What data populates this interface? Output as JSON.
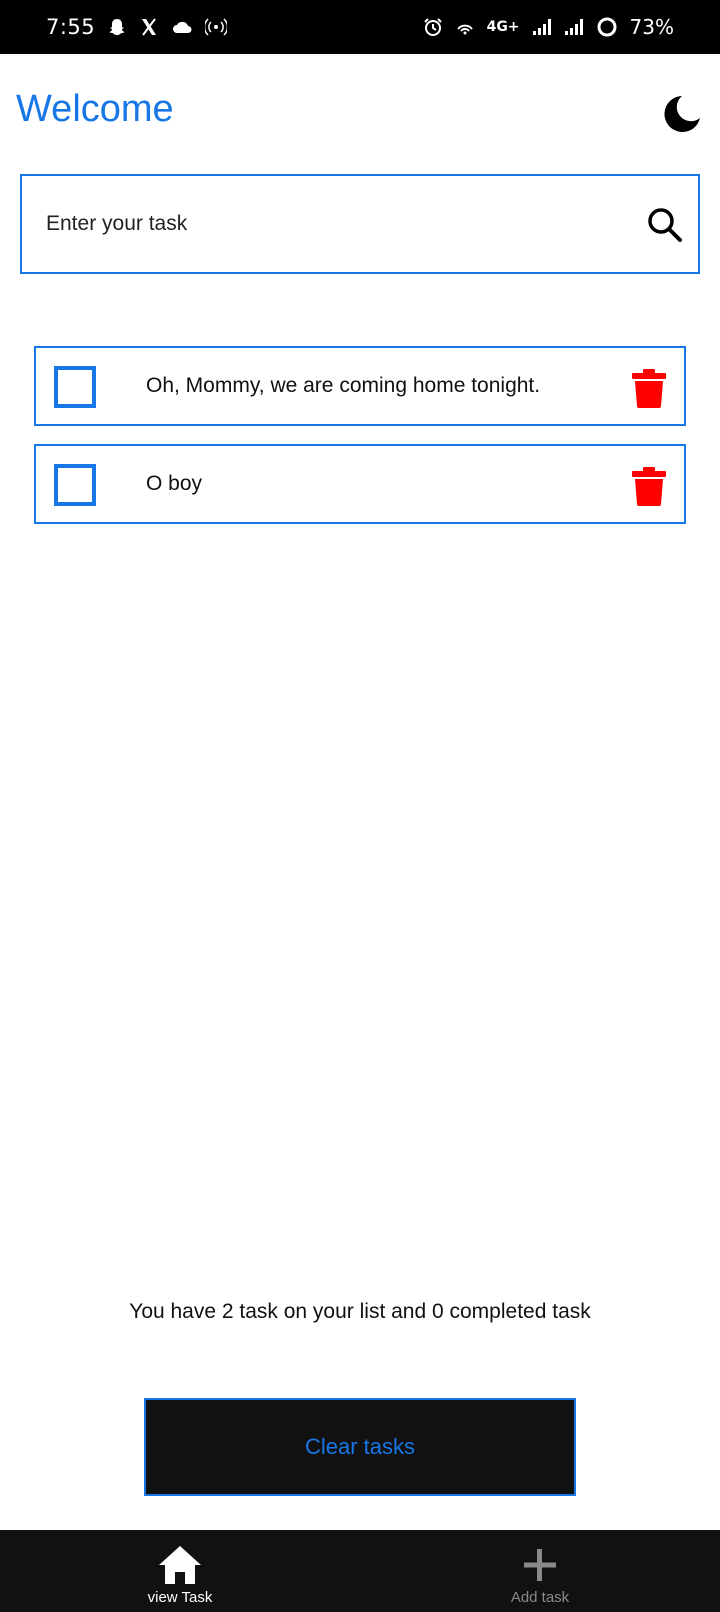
{
  "status_bar": {
    "time": "7:55",
    "network": "4G+",
    "battery": "73%",
    "icons": [
      "snapchat-icon",
      "x-icon",
      "cloud-icon",
      "hotspot-icon",
      "alarm-icon",
      "wifi-calling-icon",
      "signal-icon",
      "signal-icon",
      "battery-icon"
    ]
  },
  "header": {
    "title": "Welcome",
    "theme_toggle_icon": "moon-icon"
  },
  "search": {
    "placeholder": "Enter your task",
    "value": "",
    "icon": "search-icon"
  },
  "tasks": [
    {
      "text": "Oh, Mommy, we are coming home tonight.",
      "completed": false
    },
    {
      "text": "O boy",
      "completed": false
    }
  ],
  "summary": "You have 2 task on your list and 0 completed task",
  "clear_button": {
    "label": "Clear tasks"
  },
  "bottom_nav": {
    "items": [
      {
        "label": "view Task",
        "icon": "home-icon",
        "active": true
      },
      {
        "label": "Add task",
        "icon": "plus-icon",
        "active": false
      }
    ]
  },
  "colors": {
    "accent": "#1877e6",
    "delete": "#ff0000",
    "dark": "#111111",
    "status_bar": "#000000",
    "inactive": "#8a8a8a"
  }
}
